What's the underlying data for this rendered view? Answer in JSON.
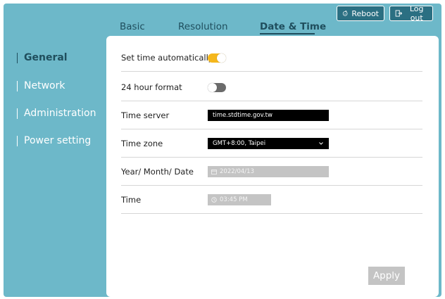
{
  "header": {
    "reboot_label": "Reboot",
    "logout_label": "Log out"
  },
  "tabs": [
    {
      "label": "Basic",
      "active": false
    },
    {
      "label": "Resolution",
      "active": false
    },
    {
      "label": "Date & Time",
      "active": true
    }
  ],
  "sidebar": {
    "items": [
      {
        "label": "General",
        "active": true
      },
      {
        "label": "Network",
        "active": false
      },
      {
        "label": "Administration",
        "active": false
      },
      {
        "label": "Power setting",
        "active": false
      }
    ]
  },
  "settings": {
    "auto_time": {
      "label": "Set time automatically",
      "enabled": true
    },
    "hour24": {
      "label": "24 hour format",
      "enabled": false
    },
    "time_server": {
      "label": "Time server",
      "value": "time.stdtime.gov.tw"
    },
    "time_zone": {
      "label": "Time zone",
      "value": "GMT+8:00, Taipei"
    },
    "date": {
      "label": "Year/ Month/ Date",
      "value": "2022/04/13"
    },
    "time": {
      "label": "Time",
      "value": "03:45 PM"
    }
  },
  "apply_label": "Apply",
  "colors": {
    "background": "#6db8c9",
    "accent_dark": "#1f4e5d",
    "toggle_on": "#f5b71c",
    "toggle_off": "#6b6b6b",
    "disabled_field": "#c4c4c4"
  },
  "icons": {
    "reboot": "reboot-icon",
    "logout": "logout-icon",
    "dropdown": "chevron-down-icon",
    "calendar": "calendar-icon",
    "clock": "clock-icon"
  }
}
